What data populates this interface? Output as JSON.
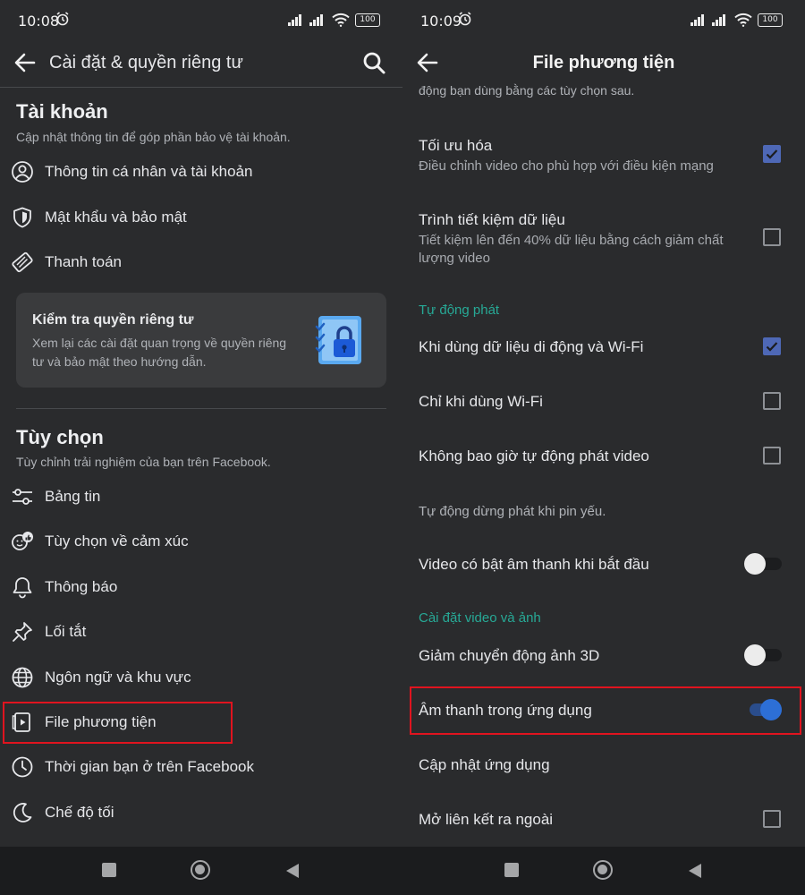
{
  "left": {
    "status": {
      "time": "10:08",
      "battery": "100"
    },
    "header": {
      "title": "Cài đặt & quyền riêng tư"
    },
    "account": {
      "title": "Tài khoản",
      "subtitle": "Cập nhật thông tin để góp phần bảo vệ tài khoản.",
      "items": [
        {
          "label": "Thông tin cá nhân và tài khoản",
          "icon": "person-circle-icon"
        },
        {
          "label": "Mật khẩu và bảo mật",
          "icon": "shield-icon"
        },
        {
          "label": "Thanh toán",
          "icon": "tag-icon"
        }
      ]
    },
    "privacy_card": {
      "title": "Kiểm tra quyền riêng tư",
      "description": "Xem lại các cài đặt quan trọng về quyền riêng tư và bảo mật theo hướng dẫn.",
      "illustration": "checklist-lock-icon"
    },
    "preferences": {
      "title": "Tùy chọn",
      "subtitle": "Tùy chỉnh trải nghiệm của bạn trên Facebook.",
      "items": [
        {
          "label": "Bảng tin",
          "icon": "sliders-icon"
        },
        {
          "label": "Tùy chọn về cảm xúc",
          "icon": "reactions-icon"
        },
        {
          "label": "Thông báo",
          "icon": "bell-icon"
        },
        {
          "label": "Lối tắt",
          "icon": "pin-icon"
        },
        {
          "label": "Ngôn ngữ và khu vực",
          "icon": "globe-icon"
        },
        {
          "label": "File phương tiện",
          "icon": "media-file-icon"
        },
        {
          "label": "Thời gian bạn ở trên Facebook",
          "icon": "clock-icon"
        },
        {
          "label": "Chế độ tối",
          "icon": "moon-icon"
        }
      ]
    }
  },
  "right": {
    "status": {
      "time": "10:09",
      "battery": "100"
    },
    "header": {
      "title": "File phương tiện"
    },
    "cut_text": "động bạn dùng bằng các tùy chọn sau.",
    "video_quality": [
      {
        "label": "Tối ưu hóa",
        "description": "Điều chỉnh video cho phù hợp với điều kiện mạng",
        "checked": true
      },
      {
        "label": "Trình tiết kiệm dữ liệu",
        "description": "Tiết kiệm lên đến 40% dữ liệu bằng cách giảm chất lượng video",
        "checked": false
      }
    ],
    "autoplay": {
      "header": "Tự động phát",
      "options": [
        {
          "label": "Khi dùng dữ liệu di động và Wi-Fi",
          "checked": true
        },
        {
          "label": "Chỉ khi dùng Wi-Fi",
          "checked": false
        },
        {
          "label": "Không bao giờ tự động phát video",
          "checked": false
        }
      ],
      "battery_note": "Tự động dừng phát khi pin yếu.",
      "sound_on_start": {
        "label": "Video có bật âm thanh khi bắt đầu",
        "on": false
      }
    },
    "video_photo": {
      "header": "Cài đặt video và ảnh",
      "reduce_3d": {
        "label": "Giảm chuyển động ảnh 3D",
        "on": false
      },
      "in_app_sound": {
        "label": "Âm thanh trong ứng dụng",
        "on": true
      },
      "app_update": {
        "label": "Cập nhật ứng dụng"
      },
      "open_links_external": {
        "label": "Mở liên kết ra ngoài",
        "checked": false
      }
    }
  },
  "colors": {
    "panel_bg": "#2a2b2d",
    "accent_teal": "#27a996",
    "checkbox_blue": "#4e68b6",
    "toggle_blue": "#2d6fd6",
    "highlight_red": "#e0141f"
  }
}
